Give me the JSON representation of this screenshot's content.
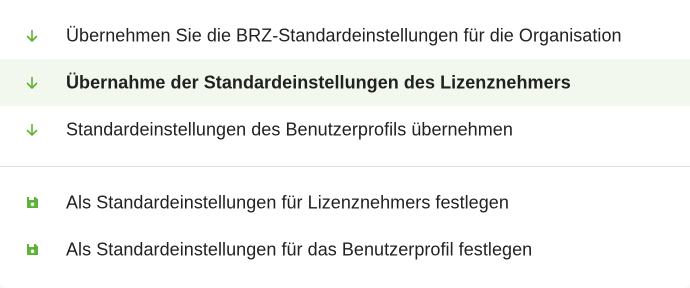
{
  "colors": {
    "accent": "#5cb335",
    "highlight_bg": "#f2f8ee",
    "text": "#212121",
    "divider": "#e0e0e0"
  },
  "menu": {
    "load_items": [
      {
        "icon": "arrow-down-icon",
        "label": "Übernehmen Sie die BRZ-Standardeinstellungen für die Organisation",
        "highlighted": false
      },
      {
        "icon": "arrow-down-icon",
        "label": "Übernahme der Standardeinstellungen des Lizenznehmers",
        "highlighted": true
      },
      {
        "icon": "arrow-down-icon",
        "label": "Standardeinstellungen des Benutzerprofils übernehmen",
        "highlighted": false
      }
    ],
    "save_items": [
      {
        "icon": "floppy-disk-icon",
        "label": "Als Standardeinstellungen für Lizenznehmers festlegen"
      },
      {
        "icon": "floppy-disk-icon",
        "label": "Als Standardeinstellungen für das Benutzerprofil festlegen"
      }
    ]
  }
}
